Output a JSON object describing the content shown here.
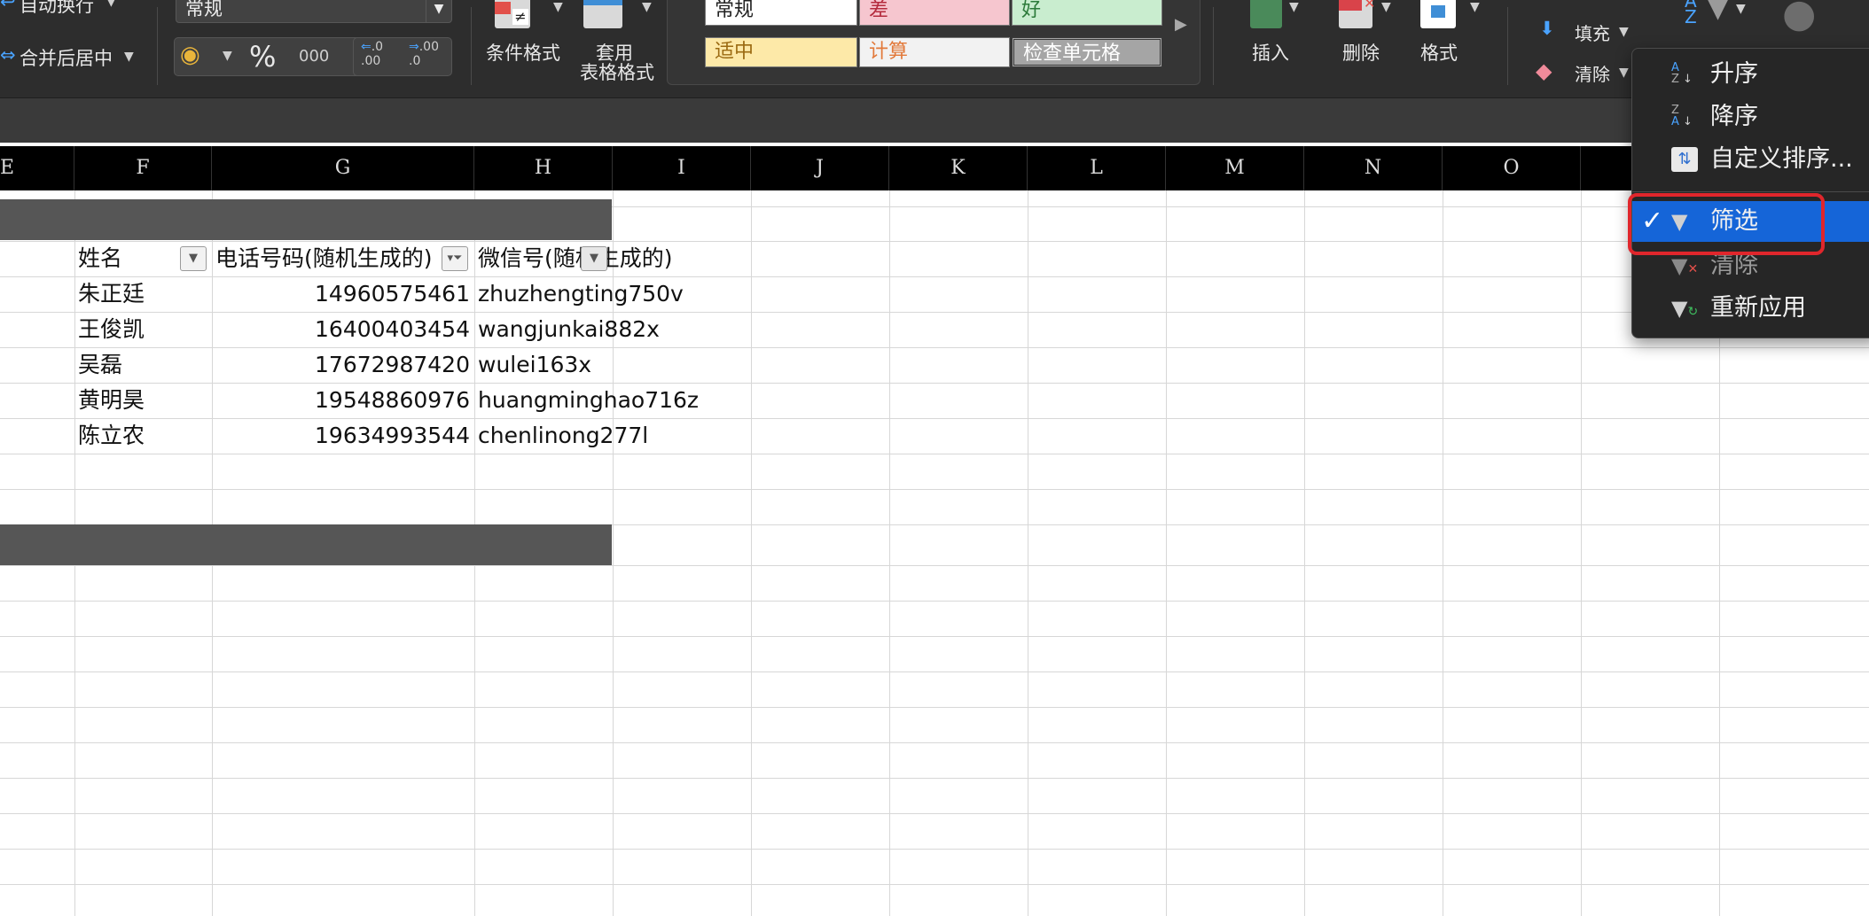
{
  "ribbon": {
    "wrap_text": "自动换行",
    "merge_center": "合并后居中",
    "number_format": "常规",
    "percent": "%",
    "thousands": "000",
    "inc_decimal": ".0\n.00",
    "dec_decimal": ".00\n.0",
    "conditional_format": "条件格式",
    "table_format_line1": "套用",
    "table_format_line2": "表格格式",
    "styles": {
      "normal": "常规",
      "bad": "差",
      "good": "好",
      "neutral": "适中",
      "calculation": "计算",
      "check_cell": "检查单元格"
    },
    "insert": "插入",
    "delete": "删除",
    "format": "格式",
    "fill": "填充",
    "clear": "清除"
  },
  "columns": [
    "E",
    "F",
    "G",
    "H",
    "I",
    "J",
    "K",
    "L",
    "M",
    "N",
    "O"
  ],
  "table": {
    "headers": {
      "name": "姓名",
      "phone": "电话号码(随机生成的)",
      "wechat": "微信号(随机生成的)"
    },
    "rows": [
      {
        "name": "朱正廷",
        "phone": "14960575461",
        "wechat": "zhuzhengting750v"
      },
      {
        "name": "王俊凯",
        "phone": "16400403454",
        "wechat": "wangjunkai882x"
      },
      {
        "name": "吴磊",
        "phone": "17672987420",
        "wechat": "wulei163x"
      },
      {
        "name": "黄明昊",
        "phone": "19548860976",
        "wechat": "huangminghao716z"
      },
      {
        "name": "陈立农",
        "phone": "19634993544",
        "wechat": "chenlinong277l"
      }
    ]
  },
  "menu": {
    "items": [
      {
        "label": "升序",
        "icon": "sort-ascending-icon"
      },
      {
        "label": "降序",
        "icon": "sort-descending-icon"
      },
      {
        "label": "自定义排序...",
        "icon": "custom-sort-icon"
      },
      {
        "label": "筛选",
        "icon": "filter-icon",
        "checked": true
      },
      {
        "label": "清除",
        "icon": "clear-filter-icon"
      },
      {
        "label": "重新应用",
        "icon": "reapply-filter-icon"
      }
    ],
    "check_mark": "✓"
  },
  "colors": {
    "selected": "#1565d8",
    "highlight": "#e0262c",
    "ribbon": "#2d2d2d"
  }
}
